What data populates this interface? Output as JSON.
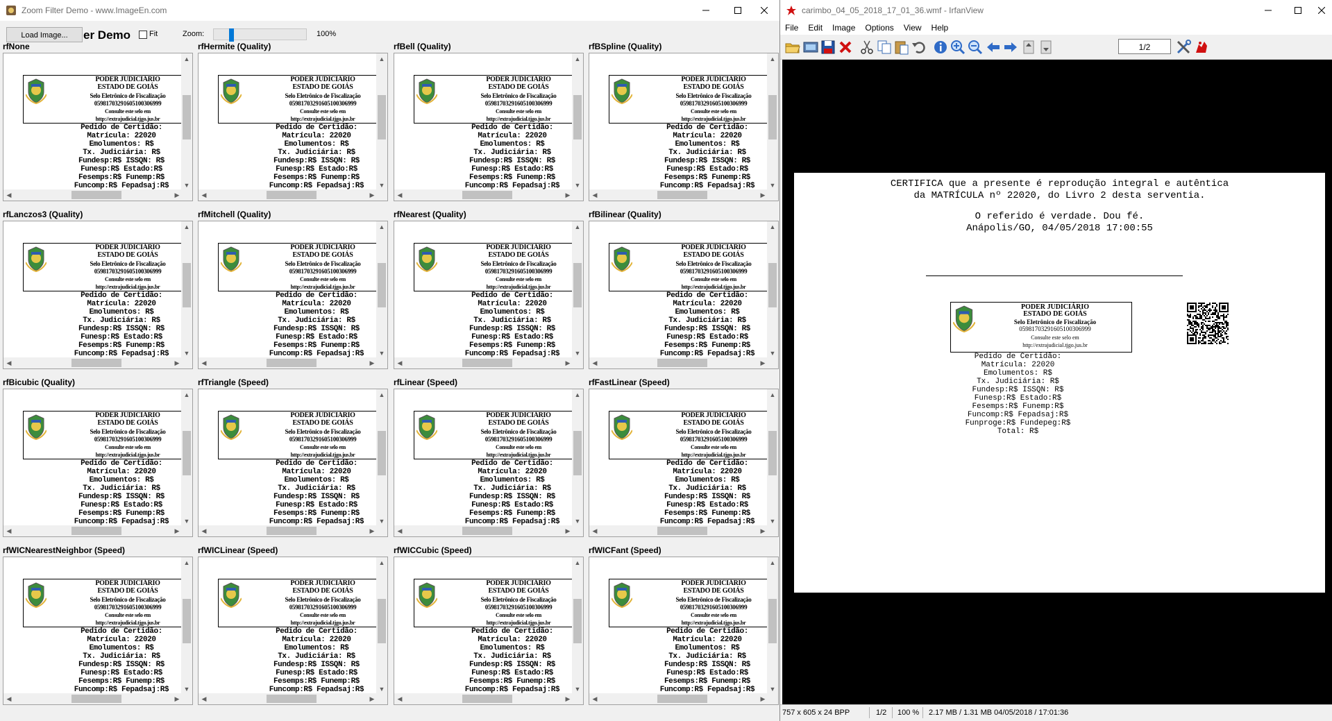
{
  "left_window": {
    "title": "Zoom Filter Demo - www.ImageEn.com",
    "toolbar": {
      "load_button": "Load Image...",
      "demo_title": "er Demo",
      "fit_label": "Fit",
      "zoom_label": "Zoom:",
      "zoom_value": "100%",
      "zoom_slider_level_percent": 14
    },
    "filters": [
      "rfNone",
      "rfHermite (Quality)",
      "rfBell (Quality)",
      "rfBSpline (Quality)",
      "rfLanczos3 (Quality)",
      "rfMitchell (Quality)",
      "rfNearest (Quality)",
      "rfBilinear (Quality)",
      "rfBicubic (Quality)",
      "rfTriangle (Speed)",
      "rfLinear (Speed)",
      "rfFastLinear (Speed)",
      "rfWICNearestNeighbor (Speed)",
      "rfWICLinear (Speed)",
      "rfWICCubic (Speed)",
      "rfWICFant (Speed)"
    ],
    "preview": {
      "seal": [
        "PODER JUDICIÁRIO",
        "ESTADO DE GOIÁS",
        "Selo Eletrônico de Fiscalização",
        "05981703291605100306999",
        "Consulte este selo em",
        "http://extrajudicial.tjgo.jus.br"
      ],
      "fees": [
        "Pedido de Certidão:",
        "Matrícula: 22020",
        "Emolumentos: R$",
        "Tx. Judiciária: R$",
        "Fundesp:R$ ISSQN: R$",
        "Funesp:R$ Estado:R$",
        "Fesemps:R$ Funemp:R$",
        "Funcomp:R$ Fepadsaj:R$"
      ]
    }
  },
  "right_window": {
    "title": "carimbo_04_05_2018_17_01_36.wmf - IrfanView",
    "menu": [
      "File",
      "Edit",
      "Image",
      "Options",
      "View",
      "Help"
    ],
    "page_field": "1/2",
    "document": {
      "lines": [
        "CERTIFICA que a presente é reprodução integral e autêntica",
        "da MATRÍCULA nº 22020, do Livro 2 desta serventia.",
        "O referido é verdade. Dou fé.",
        "Anápolis/GO, 04/05/2018 17:00:55"
      ],
      "seal": [
        "PODER JUDICIÁRIO",
        "ESTADO DE GOIÁS",
        "Selo Eletrônico de Fiscalização",
        "05981703291605100306999",
        "Consulte este selo em",
        "http://extrajudicial.tjgo.jus.br"
      ],
      "fees": [
        "Pedido de Certidão:",
        "Matrícula: 22020",
        "Emolumentos: R$",
        "Tx. Judiciária: R$",
        "Fundesp:R$ ISSQN: R$",
        "Funesp:R$ Estado:R$",
        "Fesemps:R$ Funemp:R$",
        "Funcomp:R$ Fepadsaj:R$",
        "Funproge:R$ Fundepeg:R$",
        "Total: R$"
      ]
    },
    "status": {
      "dimensions": "757 x 605 x 24 BPP",
      "page": "1/2",
      "zoom": "100 %",
      "size_date": "2.17 MB / 1.31 MB 04/05/2018 / 17:01:36"
    }
  },
  "colors": {
    "accent": "#0078d7",
    "viewer_bg": "#000000",
    "panel_bg": "#ffffff",
    "chrome": "#f0f0f0"
  },
  "icons": [
    "window-icon",
    "irfanview-icon",
    "minimize-icon",
    "maximize-icon",
    "close-icon"
  ]
}
